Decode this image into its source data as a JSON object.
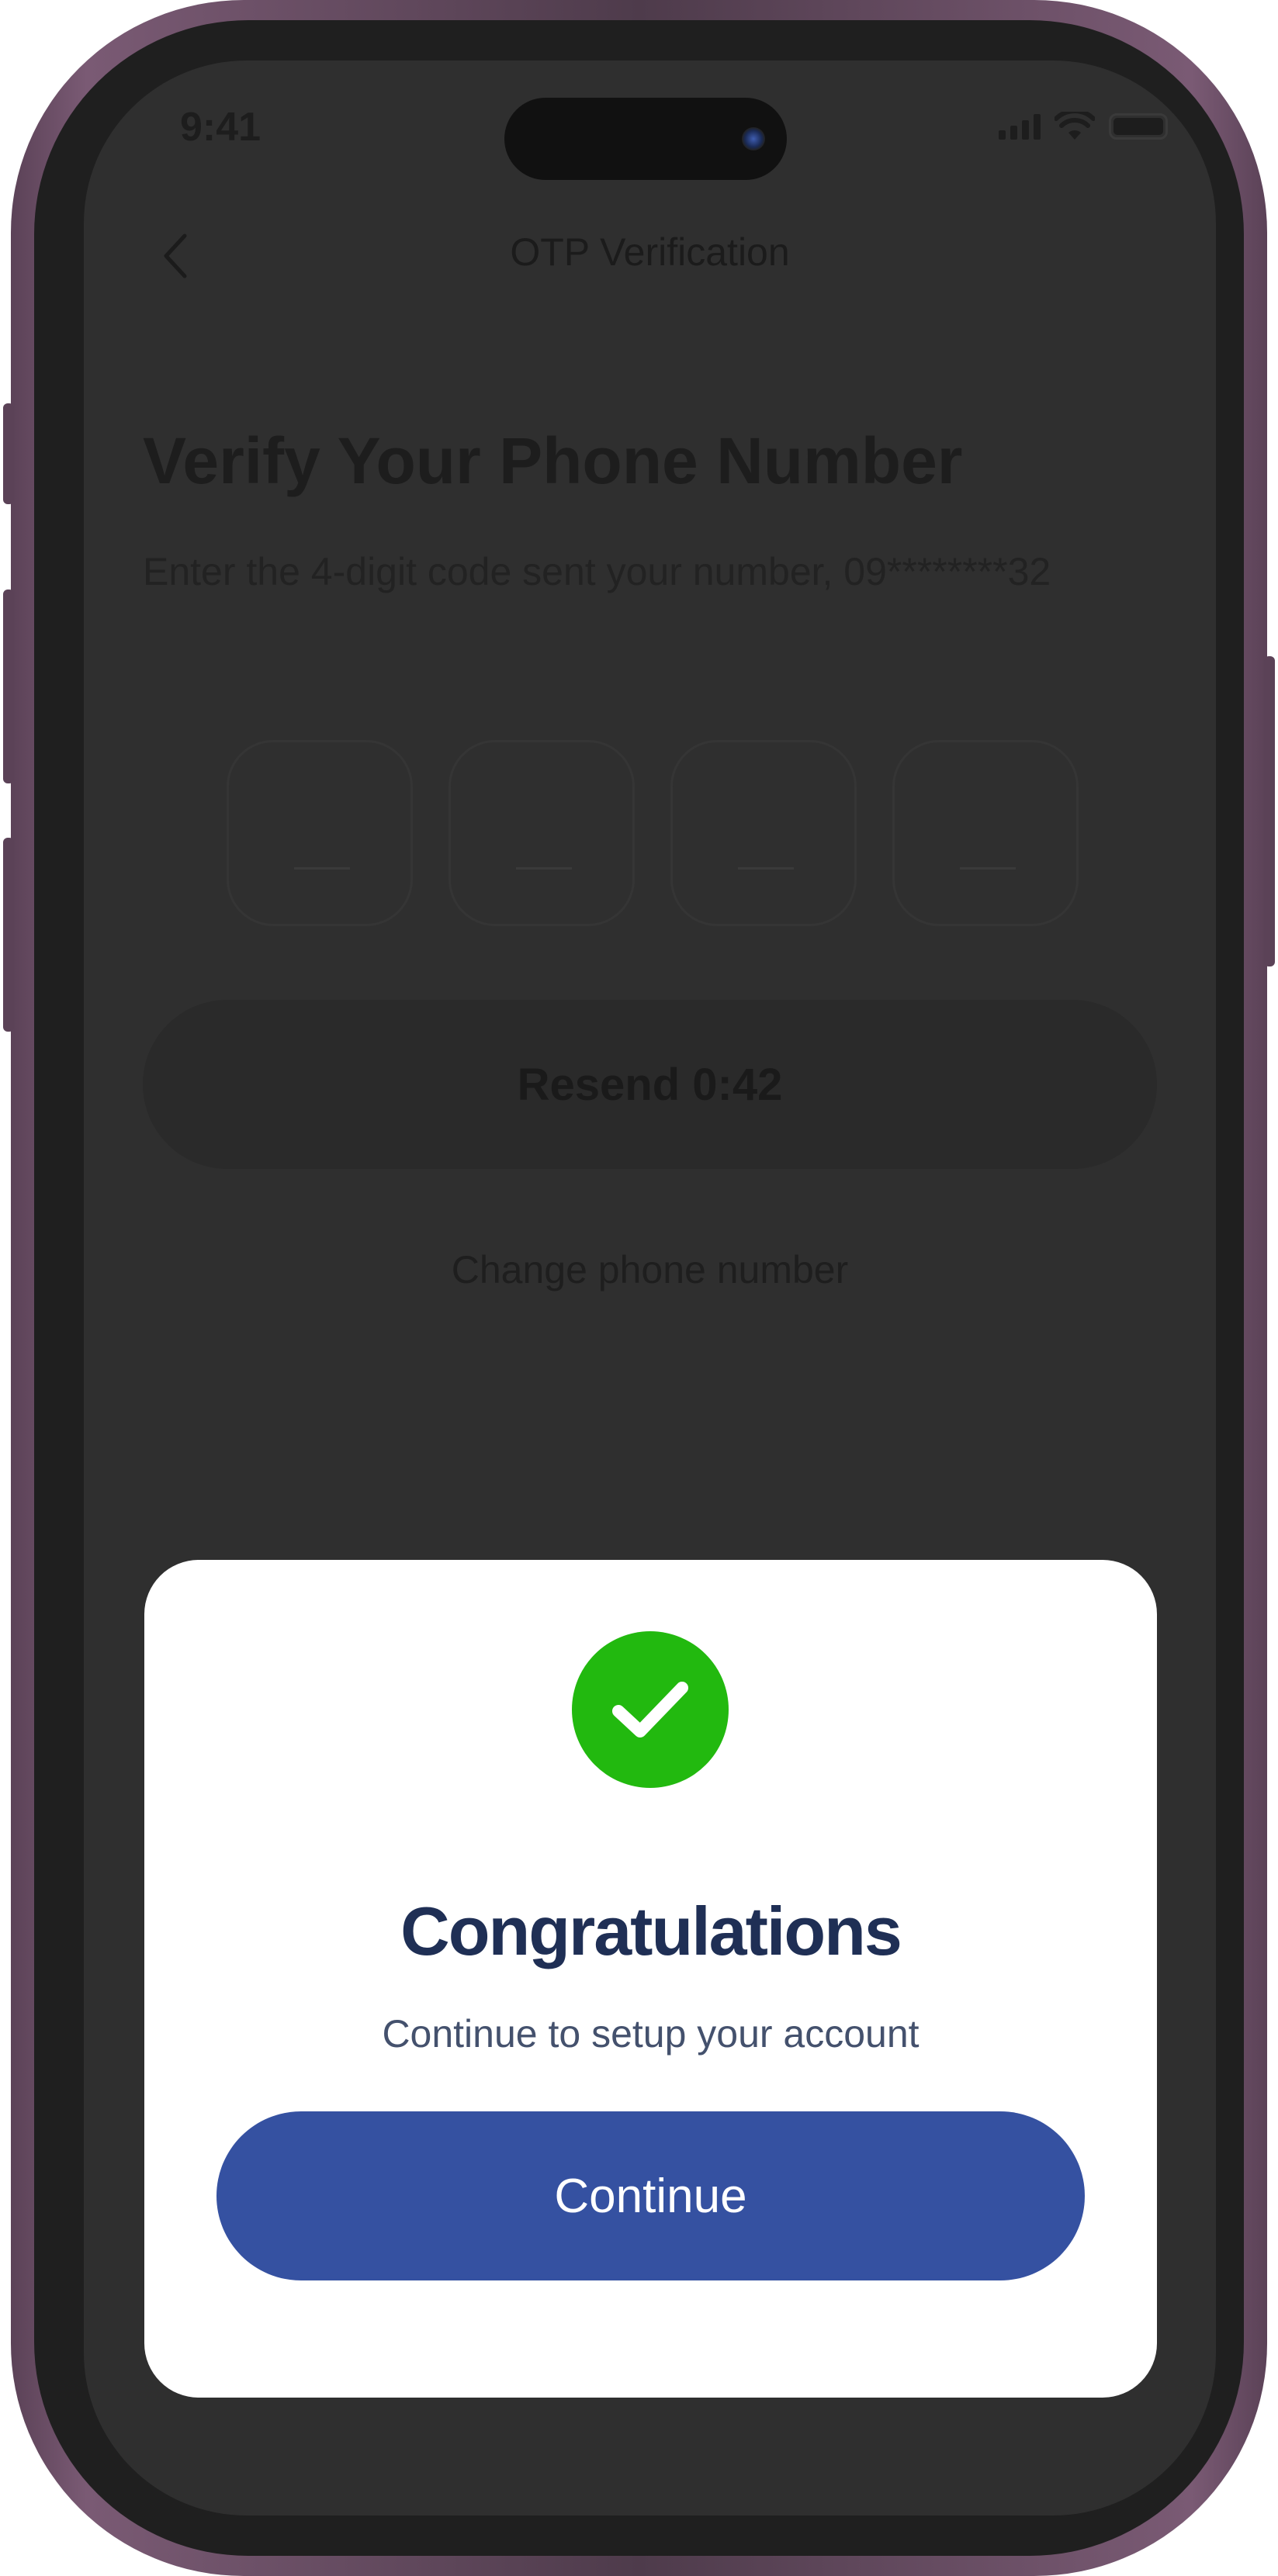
{
  "status_bar": {
    "time": "9:41"
  },
  "header": {
    "title": "OTP Verification"
  },
  "page": {
    "heading": "Verify Your Phone Number",
    "subtitle": "Enter the 4-digit code sent your number, 09********32"
  },
  "otp": {
    "digits": [
      "",
      "",
      "",
      ""
    ]
  },
  "resend_button": {
    "label": "Resend 0:42"
  },
  "change_phone_link": {
    "label": "Change phone number"
  },
  "modal": {
    "title": "Congratulations",
    "subtitle": "Continue to setup your account",
    "continue_label": "Continue"
  },
  "colors": {
    "success": "#22b90f",
    "primary": "#3551a1",
    "title_text": "#1f2f55",
    "overlay": "#2f2f2f"
  },
  "icons": {
    "back": "chevron-left-icon",
    "success": "check-icon",
    "signal": "signal-icon",
    "wifi": "wifi-icon",
    "battery": "battery-icon"
  }
}
